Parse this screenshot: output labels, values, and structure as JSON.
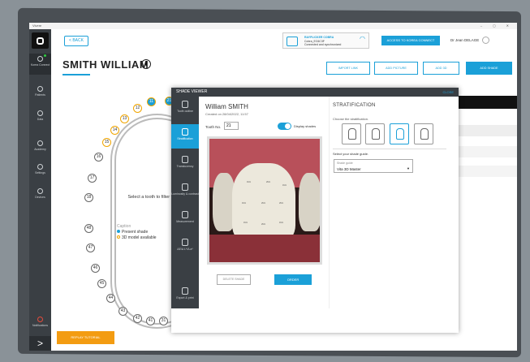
{
  "window": {
    "title": "Vivere",
    "controls": "– ◻ ✕"
  },
  "sidebar": {
    "items": [
      {
        "label": "Korea Connect",
        "icon": "link-icon",
        "active": true
      },
      {
        "label": "Patients",
        "icon": "patients-icon"
      },
      {
        "label": "Data",
        "icon": "data-icon"
      },
      {
        "label": "Academy",
        "icon": "academy-icon"
      },
      {
        "label": "Settings",
        "icon": "settings-icon"
      },
      {
        "label": "Devices",
        "icon": "devices-icon"
      },
      {
        "label": "Notifications",
        "icon": "bell-icon"
      }
    ],
    "expand": ">"
  },
  "header": {
    "back": "< BACK",
    "device": {
      "line1": "RAYPLICKER COBRA",
      "line2": "Cobra_EC6C3F",
      "line3": "Connected and synchronized"
    },
    "korea_btn": "ACCESS TO KOREA CONNECT",
    "user": "Dr Jean DELAGE"
  },
  "patient": {
    "name": "SMITH WILLIAM",
    "info": "i"
  },
  "actions": [
    {
      "label": "IMPORT LINK"
    },
    {
      "label": "ADD PICTURE"
    },
    {
      "label": "ADD 3D"
    },
    {
      "label": "ADD SHADE"
    }
  ],
  "chart": {
    "teeth": [
      "12",
      "11",
      "21",
      "13",
      "14",
      "15",
      "16",
      "17",
      "18",
      "48",
      "47",
      "46",
      "45",
      "44",
      "43",
      "42",
      "41",
      "31",
      "32",
      "33"
    ],
    "select_text": "Select a tooth to filter the data",
    "caption_title": "Caption",
    "caption_present": "Present shade",
    "caption_model": "3D model available"
  },
  "replay": "REPLAY TUTORIAL",
  "viewer": {
    "title": "SHADE VIEWER",
    "close": "CLOSE",
    "tabs": [
      "Tooth outline",
      "Stratification",
      "Translucency",
      "Luminosity & contrast",
      "Measurement",
      "ΔE/Δ L*/Δ a*",
      "Export & print"
    ],
    "patient_name": "William SMITH",
    "created": "Created on 28/04/2022, 11:57",
    "tooth_label": "Tooth No.",
    "tooth_value": "21",
    "display_shades": "Display shades",
    "zones": [
      "1M1",
      "2M1",
      "1M1",
      "1M1",
      "2M1",
      "2M1",
      "1M1",
      "2M1",
      "1M1"
    ],
    "delete": "DELETE SHADE",
    "order": "ORDER",
    "strat": {
      "title": "STRATIFICATION",
      "choose": "Choose the stratification.",
      "guide_label": "Select your shade guide.",
      "guide_placeholder": "Shade guide",
      "guide_value": "Vita 3D Master"
    }
  }
}
